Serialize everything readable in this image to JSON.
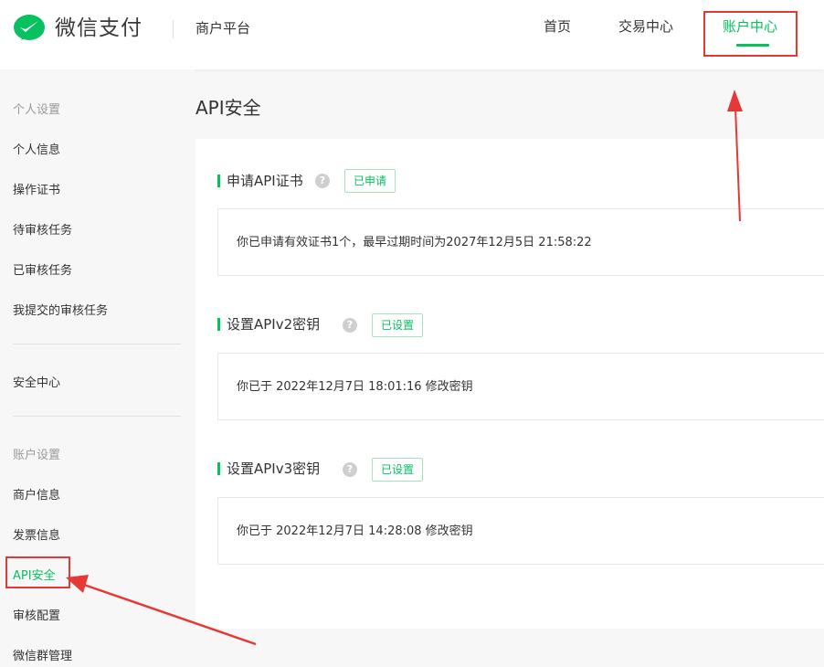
{
  "header": {
    "brand": "微信支付",
    "subtitle": "商户平台",
    "nav": [
      {
        "label": "首页"
      },
      {
        "label": "交易中心"
      },
      {
        "label": "账户中心"
      }
    ]
  },
  "sidebar": {
    "group_personal": "个人设置",
    "personal_items": [
      "个人信息",
      "操作证书",
      "待审核任务",
      "已审核任务",
      "我提交的审核任务"
    ],
    "security_center": "安全中心",
    "group_account": "账户设置",
    "account_items": [
      "商户信息",
      "发票信息",
      "API安全",
      "审核配置",
      "微信群管理"
    ]
  },
  "main": {
    "title": "API安全",
    "sections": [
      {
        "title": "申请API证书",
        "help": "?",
        "badge": "已申请",
        "info": "你已申请有效证书1个，最早过期时间为2027年12月5日 21:58:22"
      },
      {
        "title": "设置APIv2密钥",
        "help": "?",
        "badge": "已设置",
        "info": "你已于 2022年12月7日 18:01:16 修改密钥"
      },
      {
        "title": "设置APIv3密钥",
        "help": "?",
        "badge": "已设置",
        "info": "你已于 2022年12月7日 14:28:08 修改密钥"
      }
    ]
  },
  "colors": {
    "accent": "#07c160",
    "annotation": "#e53935"
  },
  "icons": {
    "logo": "wechat-pay-logo",
    "help": "question-icon"
  }
}
